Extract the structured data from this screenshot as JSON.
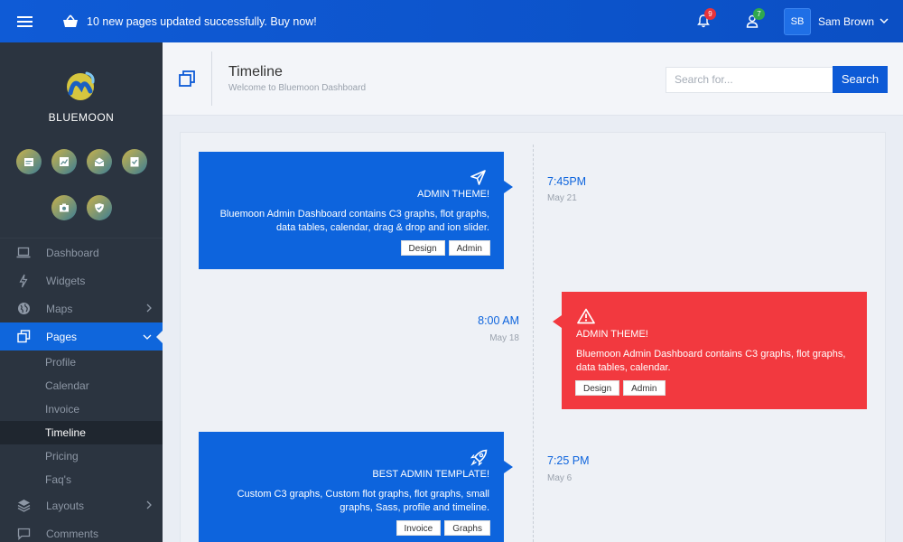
{
  "topbar": {
    "announcement": "10 new pages updated successfully. Buy now!",
    "notifications_count": "9",
    "users_count": "7",
    "user_initials": "SB",
    "user_name": "Sam Brown"
  },
  "sidebar": {
    "brand": "BLUEMOON",
    "quick_icons": [
      "calendar-icon",
      "chart-icon",
      "mail-icon",
      "checklist-icon",
      "camera-icon",
      "shield-icon"
    ],
    "nav": [
      {
        "label": "Dashboard",
        "icon": "laptop-icon"
      },
      {
        "label": "Widgets",
        "icon": "bolt-icon"
      },
      {
        "label": "Maps",
        "icon": "globe-icon"
      },
      {
        "label": "Pages",
        "icon": "pages-icon"
      },
      {
        "label": "Layouts",
        "icon": "layers-icon"
      },
      {
        "label": "Comments",
        "icon": "comment-icon"
      }
    ],
    "pages_sub": [
      "Profile",
      "Calendar",
      "Invoice",
      "Timeline",
      "Pricing",
      "Faq's"
    ]
  },
  "header": {
    "title": "Timeline",
    "subtitle": "Welcome to Bluemoon Dashboard",
    "search_placeholder": "Search for...",
    "search_button": "Search"
  },
  "timeline": [
    {
      "title": "ADMIN THEME!",
      "text": "Bluemoon Admin Dashboard contains C3 graphs, flot graphs, data tables, calendar, drag & drop and ion slider.",
      "tags": [
        "Design",
        "Admin"
      ],
      "time": "7:45PM",
      "date": "May 21",
      "color": "#0d64dd",
      "icon": "send-icon"
    },
    {
      "title": "ADMIN THEME!",
      "text": "Bluemoon Admin Dashboard contains C3 graphs, flot graphs, data tables, calendar.",
      "tags": [
        "Design",
        "Admin"
      ],
      "time": "8:00 AM",
      "date": "May 18",
      "color": "#f2393f",
      "icon": "warning-icon"
    },
    {
      "title": "BEST ADMIN TEMPLATE!",
      "text": "Custom C3 graphs, Custom flot graphs, flot graphs, small graphs, Sass, profile and timeline.",
      "tags": [
        "Invoice",
        "Graphs"
      ],
      "time": "7:25 PM",
      "date": "May 6",
      "color": "#0d64dd",
      "icon": "rocket-icon"
    }
  ]
}
